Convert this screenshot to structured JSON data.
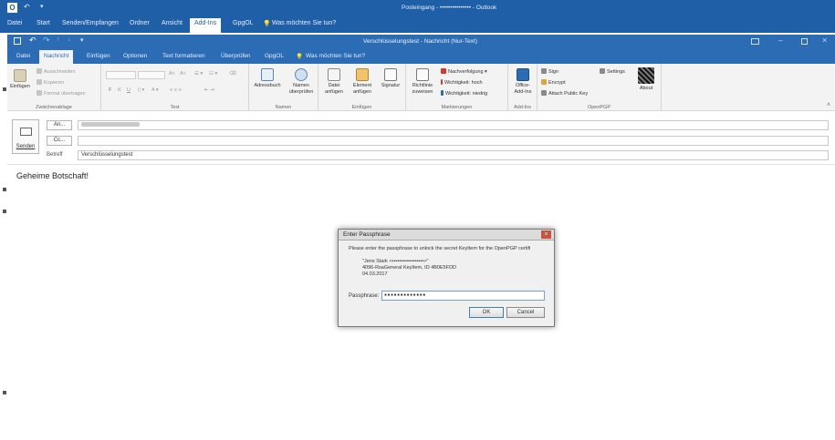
{
  "outer": {
    "title": "Posteingang - ••••••••••••••• - Outlook",
    "tabs": [
      "Datei",
      "Start",
      "Senden/Empfangen",
      "Ordner",
      "Ansicht",
      "Add-Ins",
      "GpgOL"
    ],
    "active_tab": "Add-Ins",
    "tell_me": "Was möchten Sie tun?"
  },
  "message": {
    "title": "Verschlüsselungstest - Nachricht (Nur-Text)",
    "tabs": [
      "Datei",
      "Nachricht",
      "Einfügen",
      "Optionen",
      "Text formatieren",
      "Überprüfen",
      "GpgOL"
    ],
    "active_tab": "Nachricht",
    "tell_me": "Was möchten Sie tun?"
  },
  "ribbon": {
    "clipboard": {
      "paste": "Einfügen",
      "cut": "Ausschneiden",
      "copy": "Kopieren",
      "format": "Format übertragen",
      "label": "Zwischenablage"
    },
    "text": {
      "font": "",
      "size": "",
      "bold": "F",
      "italic": "K",
      "underline": "U",
      "label": "Text"
    },
    "names": {
      "address_book": "Adressbuch",
      "check_names": [
        "Namen",
        "überprüfen"
      ],
      "label": "Namen"
    },
    "include": {
      "attach_file": [
        "Datei",
        "anfügen"
      ],
      "attach_item": [
        "Element",
        "anfügen"
      ],
      "signature": "Signatur",
      "label": "Einfügen"
    },
    "tags": {
      "policy": [
        "Richtlinie",
        "zuweisen"
      ],
      "follow_up": "Nachverfolgung",
      "high": "Wichtigkeit: hoch",
      "low": "Wichtigkeit: niedrig",
      "label": "Markierungen"
    },
    "addins": {
      "office": [
        "Office-",
        "Add-Ins"
      ],
      "label": "Add-Ins"
    },
    "openpgp": {
      "sign": "Sign",
      "encrypt": "Encrypt",
      "attach_key": "Attach Public Key",
      "settings": "Settings",
      "about": "About",
      "label": "OpenPGP"
    }
  },
  "header": {
    "send": "Senden",
    "to": "An...",
    "cc": "Cc...",
    "subject_label": "Betreff",
    "subject_value": "Verschlüsselungstest"
  },
  "body": {
    "text": "Geheime Botschaft!"
  },
  "dialog": {
    "title": "Enter Passphrase",
    "message": "Please enter the passphrase to unlock the secret KeyItem for the OpenPGP certifi",
    "key_name": "\"Jens Stark <••••••••••••••••••>\"",
    "key_info": "4096-RsaGeneral KeyItem, ID 4B0E5FDD",
    "key_date": "04.03.2017",
    "pass_label": "Passphrase:",
    "pass_value": "●●●●●●●●●●●●●",
    "ok": "OK",
    "cancel": "Cancel"
  },
  "colors": {
    "brand_blue": "#1f5fa8",
    "window_blue": "#2b6cb4"
  }
}
